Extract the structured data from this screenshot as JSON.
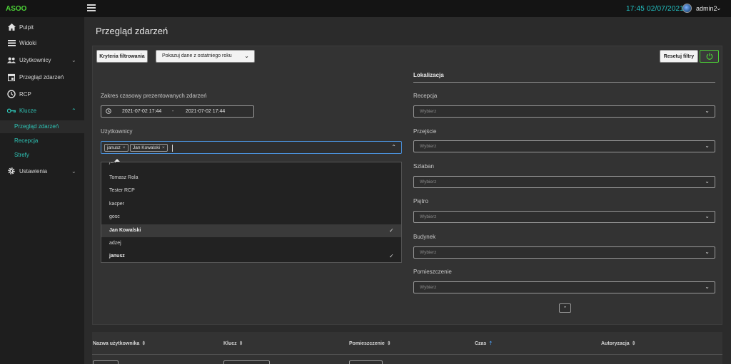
{
  "app": {
    "brand": "ASOO",
    "clock": "17:45 02/07/2021",
    "user": "admin2"
  },
  "sidebar": {
    "items": [
      {
        "label": "Pulpit",
        "icon": "home-icon"
      },
      {
        "label": "Widoki",
        "icon": "list-icon"
      },
      {
        "label": "Użytkownicy",
        "icon": "users-icon"
      },
      {
        "label": "Przegląd zdarzeń",
        "icon": "calendar-icon"
      },
      {
        "label": "RCP",
        "icon": "clock-icon"
      },
      {
        "label": "Klucze",
        "icon": "key-icon"
      },
      {
        "label": "Ustawienia",
        "icon": "gear-icon"
      }
    ],
    "sub_items": [
      "Przegląd zdarzeń",
      "Recepcja",
      "Strefy"
    ]
  },
  "page": {
    "title": "Przegląd zdarzeń"
  },
  "toolbar": {
    "filter_criteria": "Kryteria filtrowania",
    "range_select": "Pokazuj dane z ostatniego roku",
    "reset": "Resetuj filtry"
  },
  "filters": {
    "date_label": "Zakres czasowy prezentowanych zdarzeń",
    "date_from": "2021-07-02 17:44",
    "date_sep": "-",
    "date_to": "2021-07-02 17:44",
    "users_label": "Użytkownicy",
    "selected_tags": [
      "janusz",
      "Jan Kowalski"
    ],
    "tag_remove": "×",
    "options": [
      {
        "label": "Tomasz Rola",
        "selected": false
      },
      {
        "label": "Tester RCP",
        "selected": false
      },
      {
        "label": "kacper",
        "selected": false
      },
      {
        "label": "gosc",
        "selected": false
      },
      {
        "label": "Jan Kowalski",
        "selected": true
      },
      {
        "label": "adzej",
        "selected": false
      },
      {
        "label": "janusz",
        "selected": true
      }
    ],
    "partial_top": "jok"
  },
  "location": {
    "title": "Lokalizacja",
    "placeholder": "Wybierz",
    "fields": [
      "Recepcja",
      "Przejście",
      "Szlaban",
      "Piętro",
      "Budynek",
      "Pomieszczenie"
    ]
  },
  "table": {
    "columns": [
      {
        "label": "Nazwa użytkownika",
        "sort": "⇕"
      },
      {
        "label": "Klucz",
        "sort": "⇕"
      },
      {
        "label": "Pomieszczenie",
        "sort": "⇕"
      },
      {
        "label": "Czas",
        "sort": "⇡"
      },
      {
        "label": "Autoryzacja",
        "sort": "⇕"
      }
    ]
  }
}
